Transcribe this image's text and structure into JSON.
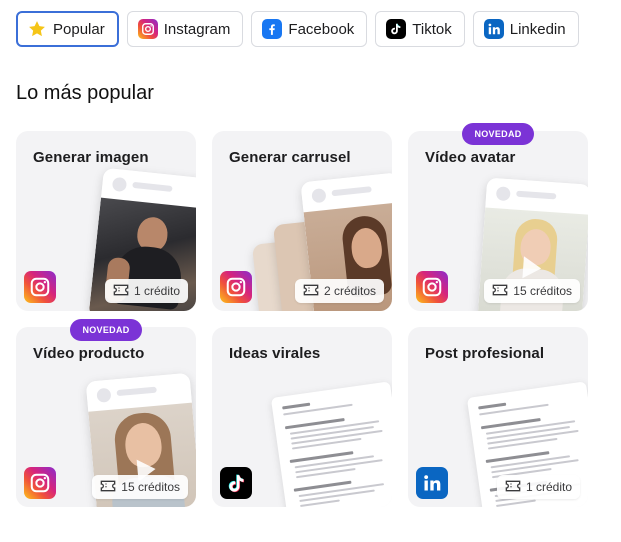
{
  "tabs": [
    {
      "label": "Popular",
      "icon": "star-icon",
      "active": true
    },
    {
      "label": "Instagram",
      "icon": "instagram-icon"
    },
    {
      "label": "Facebook",
      "icon": "facebook-icon"
    },
    {
      "label": "Tiktok",
      "icon": "tiktok-icon"
    },
    {
      "label": "Linkedin",
      "icon": "linkedin-icon"
    }
  ],
  "section_title": "Lo más popular",
  "cards": [
    {
      "title": "Generar imagen",
      "credits": "1 crédito",
      "platform": "instagram-icon"
    },
    {
      "title": "Generar carrusel",
      "credits": "2 créditos",
      "platform": "instagram-icon"
    },
    {
      "title": "Vídeo avatar",
      "credits": "15 créditos",
      "platform": "instagram-icon",
      "badge": "NOVEDAD"
    },
    {
      "title": "Vídeo producto",
      "credits": "15 créditos",
      "platform": "instagram-icon",
      "badge": "NOVEDAD"
    },
    {
      "title": "Ideas virales",
      "credits": "",
      "platform": "tiktok-icon"
    },
    {
      "title": "Post profesional",
      "credits": "1 crédito",
      "platform": "linkedin-icon"
    }
  ],
  "colors": {
    "accent": "#3b6fd8",
    "badge": "#7b33d6",
    "card_bg": "#f3f3f5",
    "star": "#f5c518",
    "facebook": "#1877f2",
    "linkedin": "#0a66c2",
    "tiktok": "#000000"
  }
}
